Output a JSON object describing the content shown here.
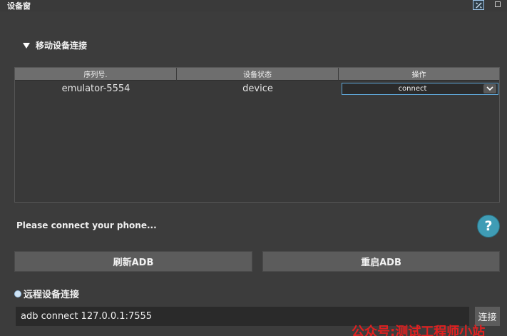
{
  "window": {
    "title": "设备窗"
  },
  "mobile_section": {
    "title": "移动设备连接"
  },
  "table": {
    "columns": [
      "序列号.",
      "设备状态",
      "操作"
    ],
    "rows": [
      {
        "serial": "emulator-5554",
        "state": "device",
        "action": "connect"
      }
    ]
  },
  "status": {
    "message": "Please connect your phone..."
  },
  "buttons": {
    "refresh": "刷新ADB",
    "restart": "重启ADB"
  },
  "remote_section": {
    "title": "远程设备连接",
    "command_value": "adb connect 127.0.0.1:7555",
    "connect_label": "连接"
  },
  "watermark": {
    "text": "公众号:测试工程师小站"
  },
  "colors": {
    "background": "#3c3c3c",
    "header": "#6e6e6e",
    "accent": "#5fa6d6",
    "help": "#3f9cb5"
  }
}
